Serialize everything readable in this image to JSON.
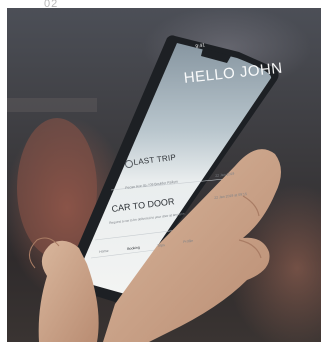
{
  "slide": {
    "number": "02"
  },
  "screen": {
    "status_time": "9:41",
    "greeting": "HELLO JOHN",
    "last_trip": {
      "title": "LAST TRIP",
      "date": "22 Jan 2019",
      "description": "Pecan Ave 45 / 09 Boulder Railyrs"
    },
    "car_to_door": {
      "title": "CAR TO DOOR",
      "date": "22 Jan 2019 at 09:15",
      "description": "Request a car to be delivered to your door at any time."
    },
    "tabs": [
      "Home",
      "Booking",
      "Trips",
      "Profile"
    ]
  },
  "colors": {
    "screen_top": "#9aa9b4",
    "screen_card": "#eceff0",
    "phone_frame": "#1d2024",
    "background": "#3b3a3d"
  }
}
